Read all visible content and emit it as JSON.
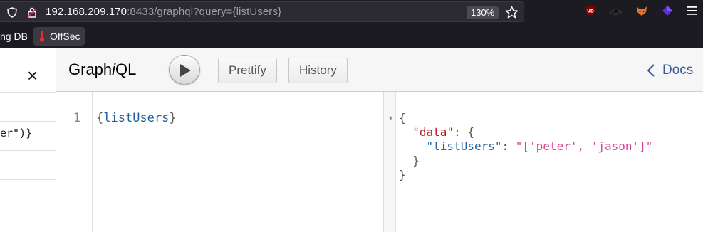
{
  "browser": {
    "url_host": "192.168.209.170",
    "url_rest": ":8433/graphql?query={listUsers}",
    "zoom": "130%",
    "bookmarks": [
      {
        "label": "ng DB"
      },
      {
        "label": "OffSec"
      }
    ],
    "icons": [
      "shield-icon",
      "lock-icon",
      "star-icon",
      "ublock-icon",
      "hat-icon",
      "fox-icon",
      "cube-icon",
      "hamburger-menu-icon"
    ]
  },
  "left_panel": {
    "close_label": "×",
    "fragment": "er\")}"
  },
  "toolbar": {
    "title_a": "Graph",
    "title_i": "i",
    "title_b": "QL",
    "prettify_label": "Prettify",
    "history_label": "History",
    "docs_label": "Docs"
  },
  "editor": {
    "line_number": "1",
    "brace_open": "{",
    "field": "listUsers",
    "brace_close": "}"
  },
  "result": {
    "line1": "{",
    "data_key": "\"data\"",
    "list_key": "\"listUsers\"",
    "list_value": "\"['peter', 'jason']\"",
    "line4": "  }",
    "line5": "}"
  },
  "colors": {
    "accent_link": "#3b5998",
    "json_key_data": "#b11a1a",
    "json_key": "#1f61a0",
    "json_string": "#d64292"
  }
}
